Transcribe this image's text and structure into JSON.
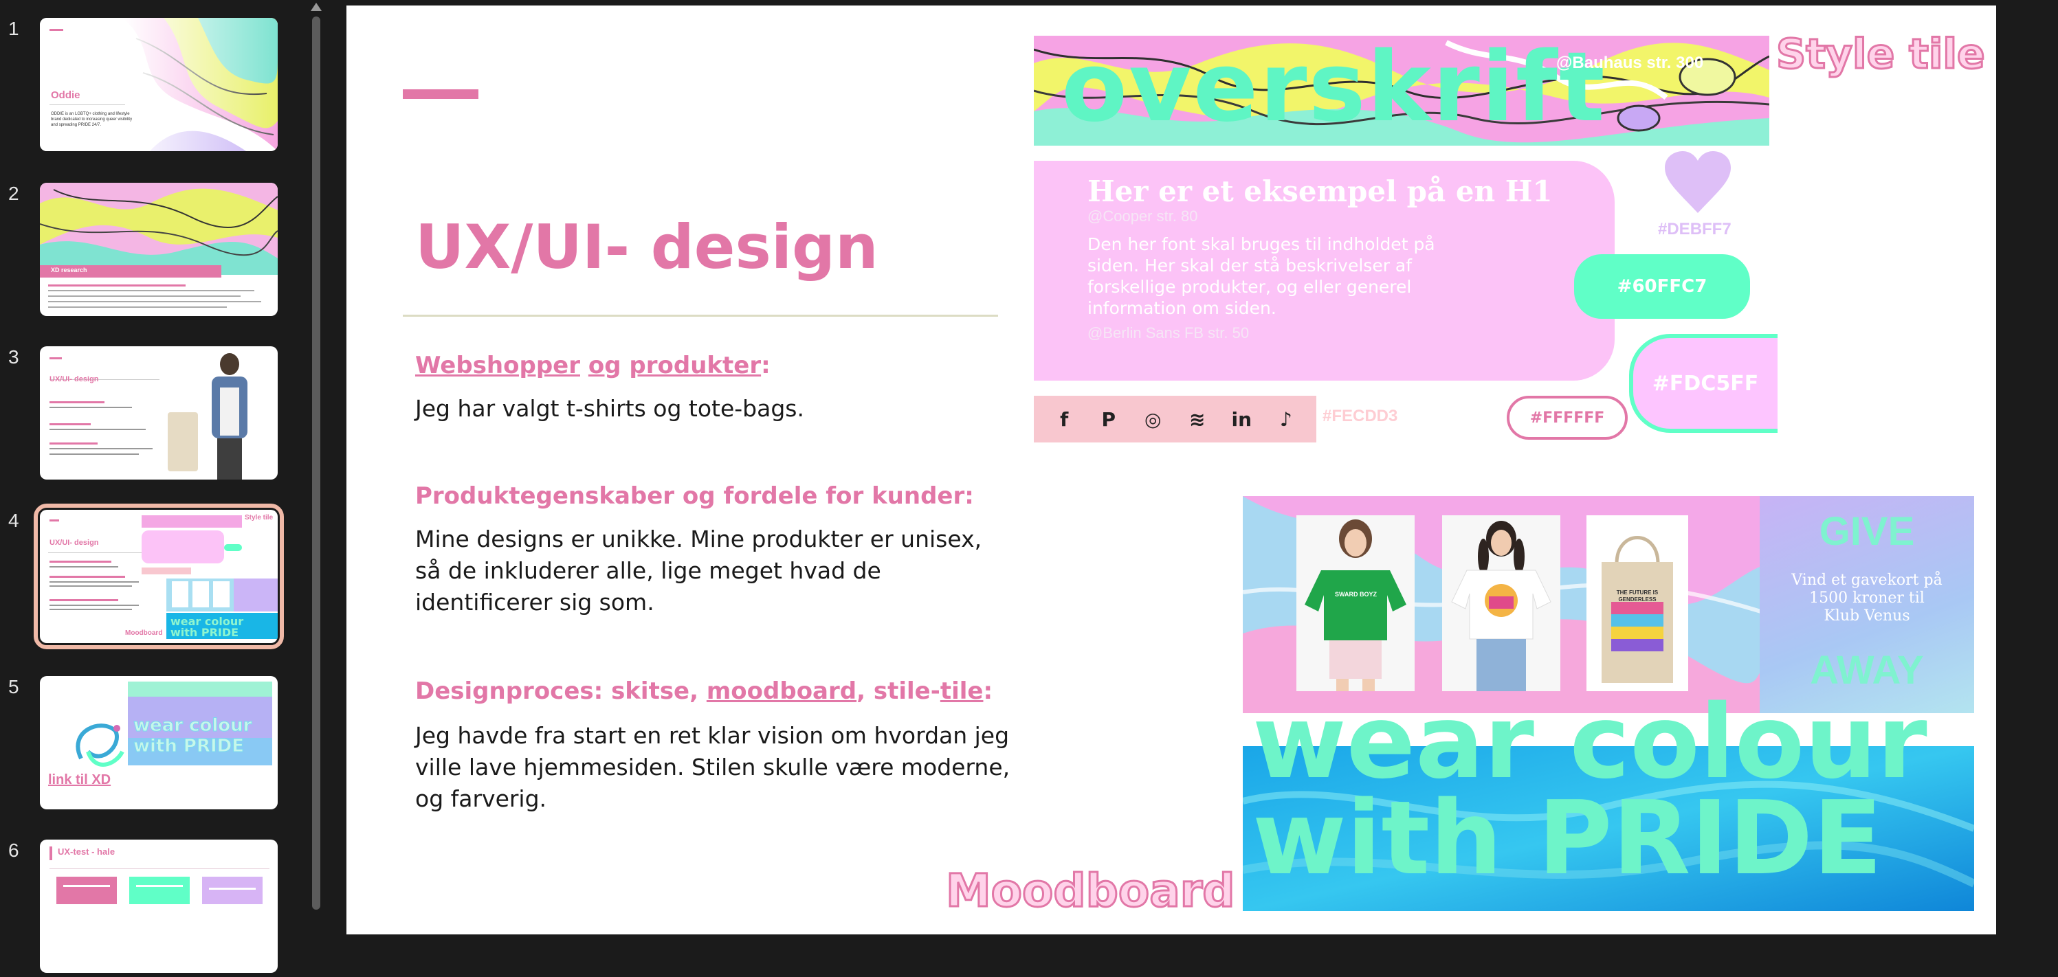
{
  "thumbnails": [
    {
      "number": "1",
      "title": "Oddie",
      "text": "ODDIE is an LGBTQ+ clothing and lifestyle brand dedicated to increasing queer visibility and spreading PRIDE 24/7."
    },
    {
      "number": "2",
      "title": "XD research"
    },
    {
      "number": "3",
      "title": "UX/UI- design"
    },
    {
      "number": "4",
      "title": "UX/UI- design",
      "moodboard": "Moodboard",
      "style_tile": "Style tile"
    },
    {
      "number": "5",
      "link": "link til XD",
      "banner": "wear colour with PRIDE"
    },
    {
      "number": "6",
      "title": "UX-test - hale"
    }
  ],
  "slide": {
    "title": "UX/UI- design",
    "sections": [
      {
        "heading_a": "Webshopper",
        "heading_b": " ",
        "heading_c": "og",
        "heading_d": " ",
        "heading_e": "produkter",
        "heading_f": ":",
        "body": "Jeg har valgt t-shirts og tote-bags."
      },
      {
        "heading": "Produktegenskaber og fordele for kunder:",
        "body": "Mine designs er unikke. Mine produkter er unisex, så de inkluderer alle, lige meget hvad de identificerer sig som."
      },
      {
        "heading_a": "Designproces: skitse, ",
        "heading_b": "moodboard",
        "heading_c": ", stile-",
        "heading_d": "tile",
        "heading_e": ":",
        "body": "Jeg havde fra start en ret klar vision om hvordan jeg ville lave hjemmesiden. Stilen skulle være moderne, og farverig."
      }
    ],
    "style_tile": {
      "label": "Style tile",
      "overskrift": "overskrift",
      "bauhaus_note": "@Bauhaus str. 300",
      "h1_example": "Her er et eksempel på en H1",
      "cooper_note": "@Cooper str. 80",
      "body_example": "Den her font skal bruges til indholdet på siden. Her skal der stå beskrivelser af forskellige produkter, og eller generel information om siden.",
      "berlin_note": "@Berlin Sans FB str. 50",
      "colors": {
        "lavender": "#DEBFF7",
        "mint": "#60FFC7",
        "pink": "#FDC5FF",
        "social": "#FECDD3",
        "white": "#FFFFFF"
      },
      "social_icons": [
        "f",
        "P",
        "◎",
        "≋",
        "in",
        "♪"
      ]
    },
    "moodboard": {
      "label": "Moodboard",
      "tshirt1_text": "SWARD BOYZ",
      "tote_text": "THE FUTURE IS GENDERLESS",
      "give": "GIVE",
      "gift_text": "Vind et gavekort på 1500 kroner til Klub Venus",
      "away": "AWAY",
      "banner_line1": "wear colour",
      "banner_line2": "with PRIDE"
    }
  }
}
